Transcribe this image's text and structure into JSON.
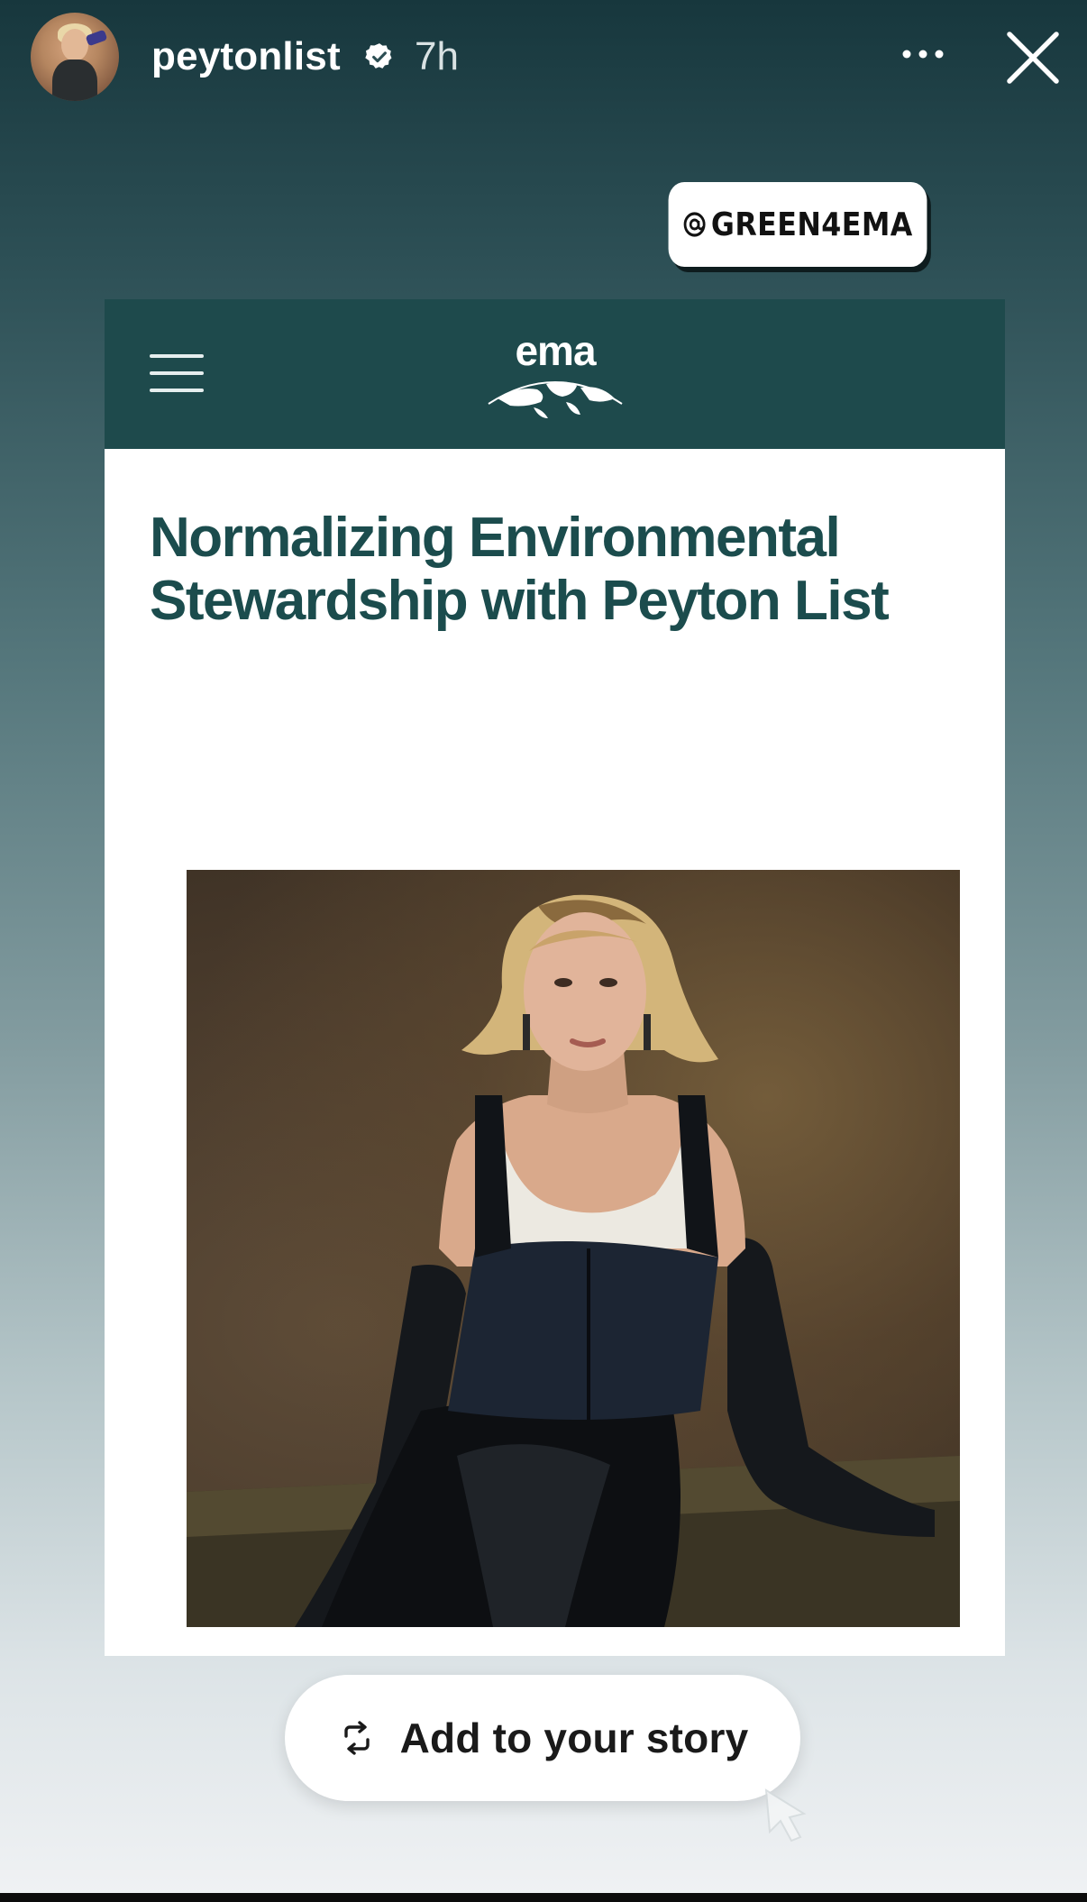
{
  "header": {
    "username": "peytonlist",
    "verified_icon": "verified-badge-icon",
    "time_ago": "7h",
    "more_icon": "more-horizontal-icon",
    "close_icon": "close-icon"
  },
  "mention_sticker": {
    "icon": "threads-at-icon",
    "handle": "GREEN4EMA"
  },
  "article": {
    "menu_icon": "hamburger-menu-icon",
    "logo_text": "ema",
    "logo_icon": "globe-icon",
    "headline": "Normalizing Environmental Stewardship with Peyton List",
    "photo_icon": "portrait-photo"
  },
  "add_to_story": {
    "icon": "repost-icon",
    "label": "Add to your story"
  },
  "colors": {
    "nav_background": "#1e4a4c",
    "headline_color": "#1b4c4d",
    "card_background": "#ffffff"
  }
}
